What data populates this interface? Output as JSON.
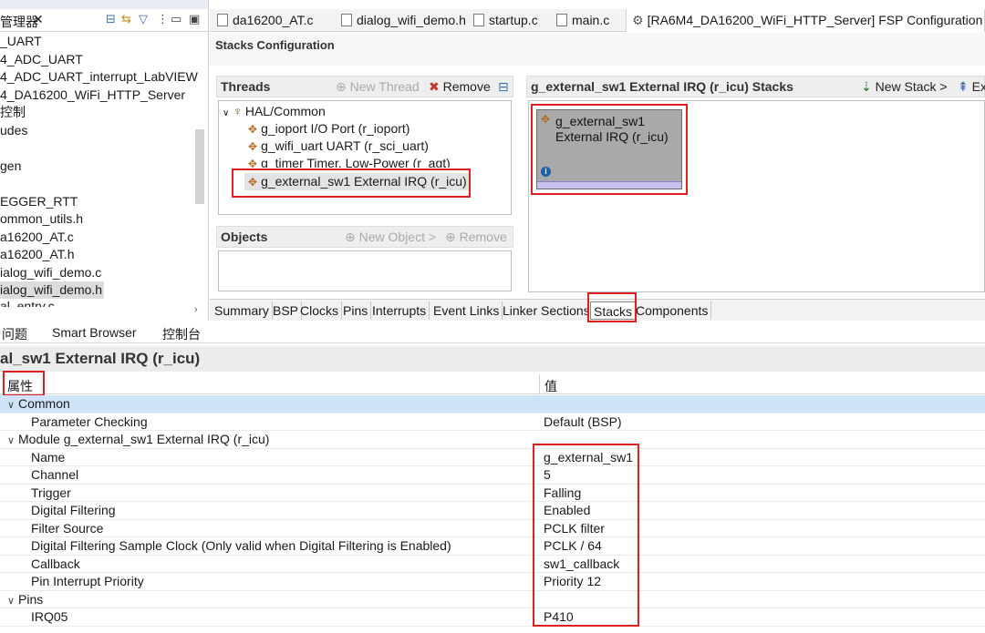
{
  "explorer": {
    "title": "管理器",
    "items": [
      "_UART",
      "4_ADC_UART",
      "4_ADC_UART_interrupt_LabVIEW",
      "4_DA16200_WiFi_HTTP_Server",
      "控制",
      "udes",
      "",
      "gen",
      "",
      "EGGER_RTT",
      "ommon_utils.h",
      "a16200_AT.c",
      "a16200_AT.h",
      "ialog_wifi_demo.c",
      "ialog_wifi_demo.h",
      "al_entry.c"
    ],
    "selected_index": 14
  },
  "editor_tabs": [
    {
      "label": "da16200_AT.c"
    },
    {
      "label": "dialog_wifi_demo.h"
    },
    {
      "label": "startup.c"
    },
    {
      "label": "main.c"
    },
    {
      "label": "[RA6M4_DA16200_WiFi_HTTP_Server] FSP Configuration"
    }
  ],
  "config": {
    "title": "Stacks Configuration",
    "threads": {
      "title": "Threads",
      "new_thread": "New Thread",
      "remove": "Remove",
      "root": "HAL/Common",
      "items": [
        "g_ioport I/O Port (r_ioport)",
        "g_wifi_uart UART (r_sci_uart)",
        "g_timer Timer, Low-Power (r_agt)",
        "g_external_sw1 External IRQ (r_icu)"
      ]
    },
    "objects": {
      "title": "Objects",
      "new_object": "New Object >",
      "remove": "Remove"
    },
    "stacks": {
      "title": "g_external_sw1 External IRQ (r_icu) Stacks",
      "new_stack": "New Stack >",
      "extract": "Ex",
      "block_line1": "g_external_sw1",
      "block_line2": "External IRQ (r_icu)"
    },
    "tabs": [
      "Summary",
      "BSP",
      "Clocks",
      "Pins",
      "Interrupts",
      "Event Links",
      "Linker Sections",
      "Stacks",
      "Components"
    ],
    "active_tab": "Stacks"
  },
  "bottom_tabs": [
    "问题",
    "Smart Browser",
    "控制台"
  ],
  "properties": {
    "title": "al_sw1 External IRQ (r_icu)",
    "col_property": "属性",
    "col_value": "值",
    "rows": [
      {
        "key": "Common",
        "value": "",
        "group": true
      },
      {
        "key": "Parameter Checking",
        "value": "Default (BSP)",
        "group": false
      },
      {
        "key": "Module g_external_sw1 External IRQ (r_icu)",
        "value": "",
        "group": true
      },
      {
        "key": "Name",
        "value": "g_external_sw1",
        "group": false
      },
      {
        "key": "Channel",
        "value": "5",
        "group": false
      },
      {
        "key": "Trigger",
        "value": "Falling",
        "group": false
      },
      {
        "key": "Digital Filtering",
        "value": "Enabled",
        "group": false
      },
      {
        "key": "Filter Source",
        "value": "PCLK filter",
        "group": false
      },
      {
        "key": "Digital Filtering Sample Clock (Only valid when Digital Filtering is Enabled)",
        "value": "PCLK / 64",
        "group": false
      },
      {
        "key": "Callback",
        "value": "sw1_callback",
        "group": false
      },
      {
        "key": "Pin Interrupt Priority",
        "value": "Priority 12",
        "group": false
      },
      {
        "key": "Pins",
        "value": "",
        "group": true
      },
      {
        "key": "IRQ05",
        "value": "P410",
        "group": false
      }
    ]
  }
}
